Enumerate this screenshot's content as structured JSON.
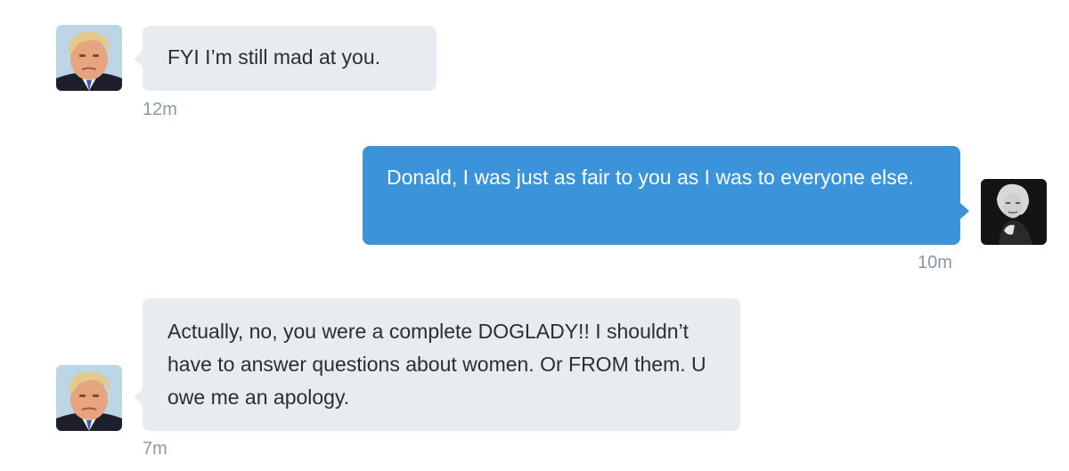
{
  "conversation": {
    "messages": [
      {
        "direction": "incoming",
        "text": "FYI I’m still mad at you.",
        "timestamp": "12m",
        "avatar_icon": "trump-avatar-icon"
      },
      {
        "direction": "outgoing",
        "text": "Donald, I was just as fair to you as I was to everyone else.",
        "timestamp": "10m",
        "avatar_icon": "megyn-avatar-icon"
      },
      {
        "direction": "incoming",
        "text": "Actually, no, you were a complete DOGLADY!! I shouldn’t have to answer questions about women. Or FROM them. U owe me an apology.",
        "timestamp": "7m",
        "avatar_icon": "trump-avatar-icon"
      }
    ]
  },
  "colors": {
    "incoming_bubble": "#e6ecf0",
    "outgoing_bubble": "#3b94d9",
    "incoming_text": "#292f33",
    "outgoing_text": "#ffffff",
    "timestamp_text": "#8899a6"
  }
}
